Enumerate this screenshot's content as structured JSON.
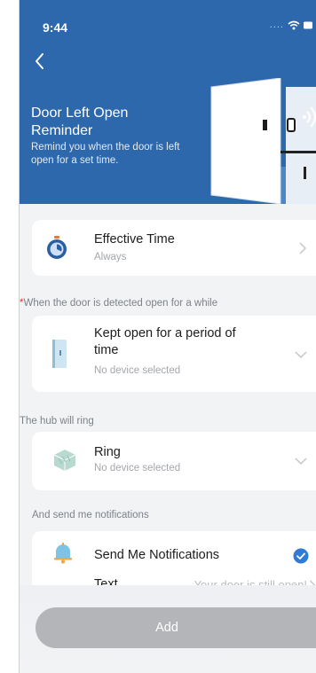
{
  "status_bar": {
    "time": "9:44",
    "signal": "...."
  },
  "header": {
    "title": "Door Left Open Reminder",
    "subtitle": "Remind you when the door is left open for a set time."
  },
  "effective_time": {
    "title": "Effective Time",
    "value": "Always"
  },
  "condition": {
    "label_star": "*",
    "label": "When the door is detected open for a while",
    "title": "Kept open for a period of time",
    "value": "No device selected"
  },
  "hub": {
    "label": "The hub will ring",
    "title": "Ring",
    "value": "No device selected"
  },
  "notifications": {
    "label": "And send me notifications",
    "title": "Send Me Notifications",
    "checked": true,
    "text_label": "Text",
    "text_value": "Your door is still open!"
  },
  "add_button": {
    "label": "Add"
  },
  "colors": {
    "header_blue": "#2d67ac",
    "accent_blue": "#2f7bd6",
    "button_disabled": "#b3b5b8",
    "required": "#e2352e"
  }
}
